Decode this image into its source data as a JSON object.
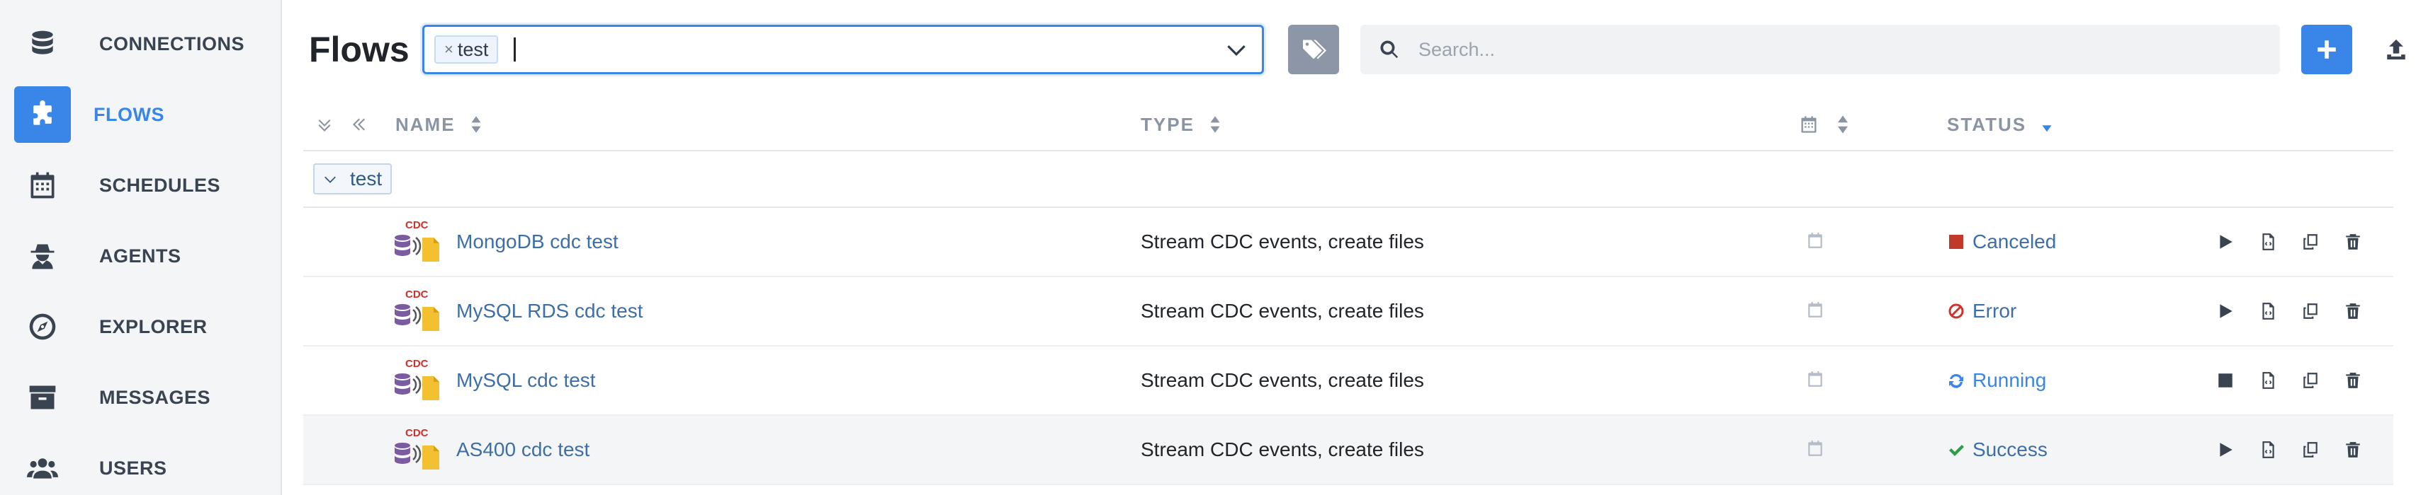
{
  "sidebar": {
    "items": [
      {
        "label": "CONNECTIONS",
        "icon": "database-icon",
        "active": false
      },
      {
        "label": "FLOWS",
        "icon": "puzzle-icon",
        "active": true
      },
      {
        "label": "SCHEDULES",
        "icon": "calendar-icon",
        "active": false
      },
      {
        "label": "AGENTS",
        "icon": "spy-agent-icon",
        "active": false
      },
      {
        "label": "EXPLORER",
        "icon": "compass-icon",
        "active": false
      },
      {
        "label": "MESSAGES",
        "icon": "archive-icon",
        "active": false
      },
      {
        "label": "USERS",
        "icon": "users-icon",
        "active": false
      }
    ]
  },
  "header": {
    "title": "Flows",
    "tag_filter": {
      "chip_label": "test",
      "chip_remove": "×"
    },
    "search": {
      "placeholder": "Search..."
    }
  },
  "table": {
    "columns": {
      "name": "NAME",
      "type": "TYPE",
      "status": "STATUS"
    },
    "group": {
      "label": "test"
    },
    "rows": [
      {
        "badge": "CDC",
        "name": "MongoDB cdc test",
        "type": "Stream CDC events, create files",
        "status": "Canceled",
        "status_icon": "stop-square-icon",
        "primary_action": "play-icon"
      },
      {
        "badge": "CDC",
        "name": "MySQL RDS cdc test",
        "type": "Stream CDC events, create files",
        "status": "Error",
        "status_icon": "ban-icon",
        "primary_action": "play-icon"
      },
      {
        "badge": "CDC",
        "name": "MySQL cdc test",
        "type": "Stream CDC events, create files",
        "status": "Running",
        "status_icon": "refresh-icon",
        "primary_action": "stop-icon"
      },
      {
        "badge": "CDC",
        "name": "AS400 cdc test",
        "type": "Stream CDC events, create files",
        "status": "Success",
        "status_icon": "check-icon",
        "primary_action": "play-icon"
      }
    ]
  },
  "colors": {
    "accent": "#3a86e8",
    "canceled": "#c0392b",
    "error": "#d0312d",
    "running": "#3a86e8",
    "success": "#2e9e44",
    "cdc_badge": "#d0312d"
  }
}
